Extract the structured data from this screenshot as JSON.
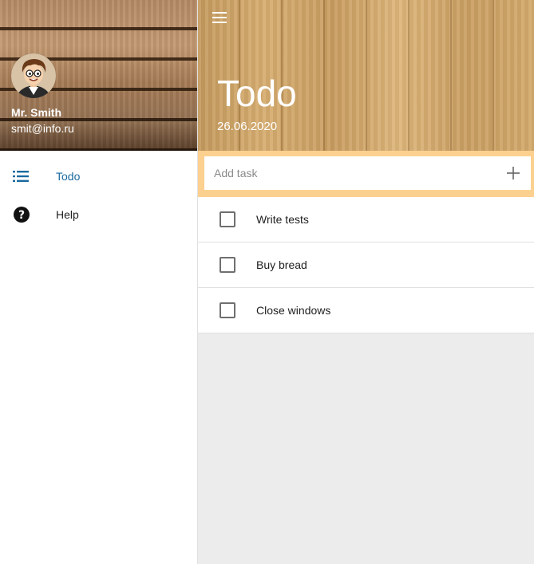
{
  "drawer": {
    "user": {
      "name": "Mr. Smith",
      "email": "smit@info.ru"
    },
    "items": [
      {
        "label": "Todo",
        "icon": "list-icon",
        "active": true
      },
      {
        "label": "Help",
        "icon": "help-icon",
        "active": false
      }
    ]
  },
  "header": {
    "title": "Todo",
    "date": "26.06.2020"
  },
  "add_task": {
    "placeholder": "Add task",
    "value": ""
  },
  "tasks": [
    {
      "text": "Write tests",
      "done": false
    },
    {
      "text": "Buy bread",
      "done": false
    },
    {
      "text": "Close windows",
      "done": false
    }
  ],
  "colors": {
    "accent": "#1a6aa0",
    "add_bar": "#fcd08f",
    "content_bg": "#ececec"
  }
}
